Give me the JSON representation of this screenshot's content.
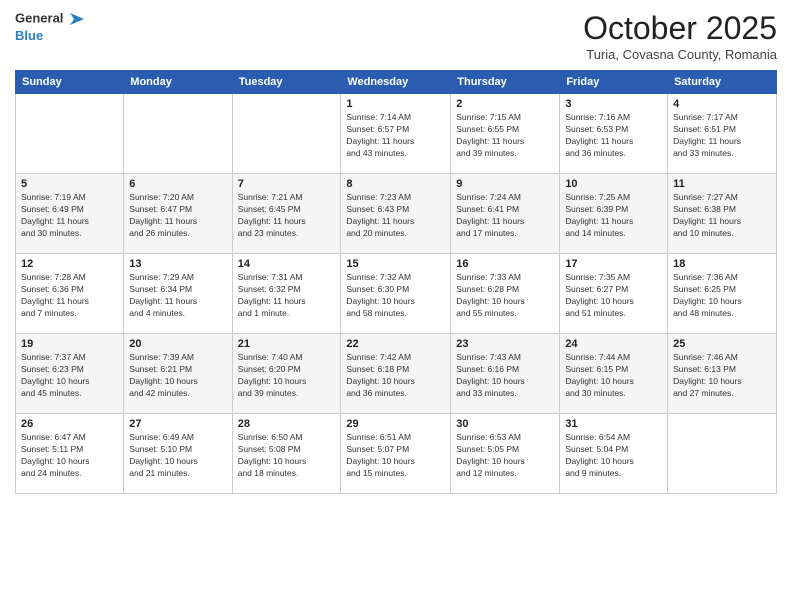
{
  "header": {
    "logo_line1": "General",
    "logo_line2": "Blue",
    "month": "October 2025",
    "location": "Turia, Covasna County, Romania"
  },
  "weekdays": [
    "Sunday",
    "Monday",
    "Tuesday",
    "Wednesday",
    "Thursday",
    "Friday",
    "Saturday"
  ],
  "weeks": [
    [
      {
        "day": "",
        "info": ""
      },
      {
        "day": "",
        "info": ""
      },
      {
        "day": "",
        "info": ""
      },
      {
        "day": "1",
        "info": "Sunrise: 7:14 AM\nSunset: 6:57 PM\nDaylight: 11 hours\nand 43 minutes."
      },
      {
        "day": "2",
        "info": "Sunrise: 7:15 AM\nSunset: 6:55 PM\nDaylight: 11 hours\nand 39 minutes."
      },
      {
        "day": "3",
        "info": "Sunrise: 7:16 AM\nSunset: 6:53 PM\nDaylight: 11 hours\nand 36 minutes."
      },
      {
        "day": "4",
        "info": "Sunrise: 7:17 AM\nSunset: 6:51 PM\nDaylight: 11 hours\nand 33 minutes."
      }
    ],
    [
      {
        "day": "5",
        "info": "Sunrise: 7:19 AM\nSunset: 6:49 PM\nDaylight: 11 hours\nand 30 minutes."
      },
      {
        "day": "6",
        "info": "Sunrise: 7:20 AM\nSunset: 6:47 PM\nDaylight: 11 hours\nand 26 minutes."
      },
      {
        "day": "7",
        "info": "Sunrise: 7:21 AM\nSunset: 6:45 PM\nDaylight: 11 hours\nand 23 minutes."
      },
      {
        "day": "8",
        "info": "Sunrise: 7:23 AM\nSunset: 6:43 PM\nDaylight: 11 hours\nand 20 minutes."
      },
      {
        "day": "9",
        "info": "Sunrise: 7:24 AM\nSunset: 6:41 PM\nDaylight: 11 hours\nand 17 minutes."
      },
      {
        "day": "10",
        "info": "Sunrise: 7:25 AM\nSunset: 6:39 PM\nDaylight: 11 hours\nand 14 minutes."
      },
      {
        "day": "11",
        "info": "Sunrise: 7:27 AM\nSunset: 6:38 PM\nDaylight: 11 hours\nand 10 minutes."
      }
    ],
    [
      {
        "day": "12",
        "info": "Sunrise: 7:28 AM\nSunset: 6:36 PM\nDaylight: 11 hours\nand 7 minutes."
      },
      {
        "day": "13",
        "info": "Sunrise: 7:29 AM\nSunset: 6:34 PM\nDaylight: 11 hours\nand 4 minutes."
      },
      {
        "day": "14",
        "info": "Sunrise: 7:31 AM\nSunset: 6:32 PM\nDaylight: 11 hours\nand 1 minute."
      },
      {
        "day": "15",
        "info": "Sunrise: 7:32 AM\nSunset: 6:30 PM\nDaylight: 10 hours\nand 58 minutes."
      },
      {
        "day": "16",
        "info": "Sunrise: 7:33 AM\nSunset: 6:28 PM\nDaylight: 10 hours\nand 55 minutes."
      },
      {
        "day": "17",
        "info": "Sunrise: 7:35 AM\nSunset: 6:27 PM\nDaylight: 10 hours\nand 51 minutes."
      },
      {
        "day": "18",
        "info": "Sunrise: 7:36 AM\nSunset: 6:25 PM\nDaylight: 10 hours\nand 48 minutes."
      }
    ],
    [
      {
        "day": "19",
        "info": "Sunrise: 7:37 AM\nSunset: 6:23 PM\nDaylight: 10 hours\nand 45 minutes."
      },
      {
        "day": "20",
        "info": "Sunrise: 7:39 AM\nSunset: 6:21 PM\nDaylight: 10 hours\nand 42 minutes."
      },
      {
        "day": "21",
        "info": "Sunrise: 7:40 AM\nSunset: 6:20 PM\nDaylight: 10 hours\nand 39 minutes."
      },
      {
        "day": "22",
        "info": "Sunrise: 7:42 AM\nSunset: 6:18 PM\nDaylight: 10 hours\nand 36 minutes."
      },
      {
        "day": "23",
        "info": "Sunrise: 7:43 AM\nSunset: 6:16 PM\nDaylight: 10 hours\nand 33 minutes."
      },
      {
        "day": "24",
        "info": "Sunrise: 7:44 AM\nSunset: 6:15 PM\nDaylight: 10 hours\nand 30 minutes."
      },
      {
        "day": "25",
        "info": "Sunrise: 7:46 AM\nSunset: 6:13 PM\nDaylight: 10 hours\nand 27 minutes."
      }
    ],
    [
      {
        "day": "26",
        "info": "Sunrise: 6:47 AM\nSunset: 5:11 PM\nDaylight: 10 hours\nand 24 minutes."
      },
      {
        "day": "27",
        "info": "Sunrise: 6:49 AM\nSunset: 5:10 PM\nDaylight: 10 hours\nand 21 minutes."
      },
      {
        "day": "28",
        "info": "Sunrise: 6:50 AM\nSunset: 5:08 PM\nDaylight: 10 hours\nand 18 minutes."
      },
      {
        "day": "29",
        "info": "Sunrise: 6:51 AM\nSunset: 5:07 PM\nDaylight: 10 hours\nand 15 minutes."
      },
      {
        "day": "30",
        "info": "Sunrise: 6:53 AM\nSunset: 5:05 PM\nDaylight: 10 hours\nand 12 minutes."
      },
      {
        "day": "31",
        "info": "Sunrise: 6:54 AM\nSunset: 5:04 PM\nDaylight: 10 hours\nand 9 minutes."
      },
      {
        "day": "",
        "info": ""
      }
    ]
  ]
}
